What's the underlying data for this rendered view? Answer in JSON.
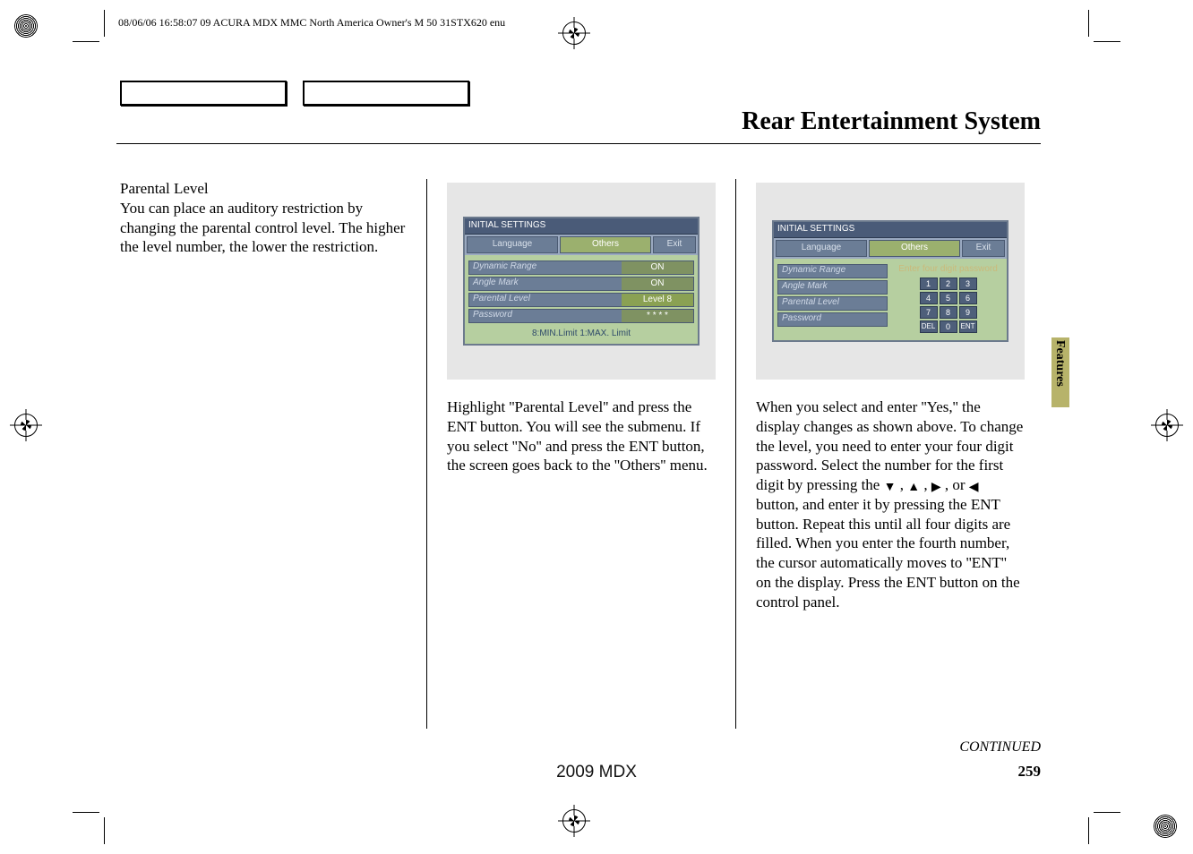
{
  "print_header": "08/06/06 16:58:07   09 ACURA MDX MMC North America Owner's M 50 31STX620 enu",
  "page": {
    "title": "Rear Entertainment System",
    "section_tab": "Features",
    "continued": "CONTINUED",
    "page_number": "259",
    "footer_model": "2009  MDX"
  },
  "col1": {
    "subhead": "Parental Level",
    "body": "You can place an auditory restriction by changing the parental control level. The higher the level number, the lower the restriction."
  },
  "col2_body": "Highlight ''Parental Level'' and press the ENT button. You will see the submenu. If you select ''No'' and press the ENT button, the screen goes back to the ''Others'' menu.",
  "col3_body_a": "When you select and enter ''Yes,'' the display changes as shown above. To change the level, you need to enter your four digit password. Select the number for the first digit by pressing the ",
  "col3_body_b": " button, and enter it by pressing the ENT button. Repeat this until all four digits are filled. When you enter the fourth number, the cursor automatically moves to ''ENT'' on the display. Press the ENT button on the control panel.",
  "screen1": {
    "header": "INITIAL  SETTINGS",
    "tabs": {
      "language": "Language",
      "others": "Others",
      "exit": "Exit"
    },
    "rows": {
      "dynamic_range": {
        "label": "Dynamic Range",
        "value": "ON"
      },
      "angle_mark": {
        "label": "Angle Mark",
        "value": "ON"
      },
      "parental_level": {
        "label": "Parental Level",
        "value": "Level 8"
      },
      "password": {
        "label": "Password",
        "value": "* * * *"
      }
    },
    "legend": "8:MIN.Limit    1:MAX. Limit"
  },
  "screen2": {
    "header": "INITIAL  SETTINGS",
    "tabs": {
      "language": "Language",
      "others": "Others",
      "exit": "Exit"
    },
    "rows": {
      "dynamic_range": {
        "label": "Dynamic Range"
      },
      "angle_mark": {
        "label": "Angle Mark"
      },
      "parental_level": {
        "label": "Parental Level"
      },
      "password": {
        "label": "Password"
      }
    },
    "keypad": {
      "prompt": "Enter four digit password",
      "keys": [
        "1",
        "2",
        "3",
        "4",
        "5",
        "6",
        "7",
        "8",
        "9",
        "DEL",
        "0",
        "ENT"
      ]
    }
  }
}
